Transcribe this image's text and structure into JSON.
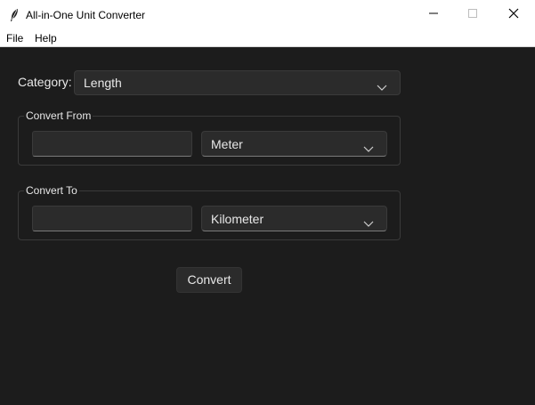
{
  "window": {
    "title": "All-in-One Unit Converter",
    "icon": "feather-icon",
    "controls": [
      "minimize-icon",
      "maximize-icon",
      "close-icon"
    ]
  },
  "menu": {
    "file": "File",
    "help": "Help"
  },
  "category": {
    "label": "Category:",
    "selected": "Length"
  },
  "convert_from": {
    "label": "Convert From",
    "value": "",
    "unit": "Meter"
  },
  "convert_to": {
    "label": "Convert To",
    "value": "",
    "unit": "Kilometer"
  },
  "convert_button": "Convert",
  "colors": {
    "background": "#1c1c1c",
    "control": "#2b2b2b",
    "text": "#e8e8e8",
    "border": "#3a3a3a"
  }
}
